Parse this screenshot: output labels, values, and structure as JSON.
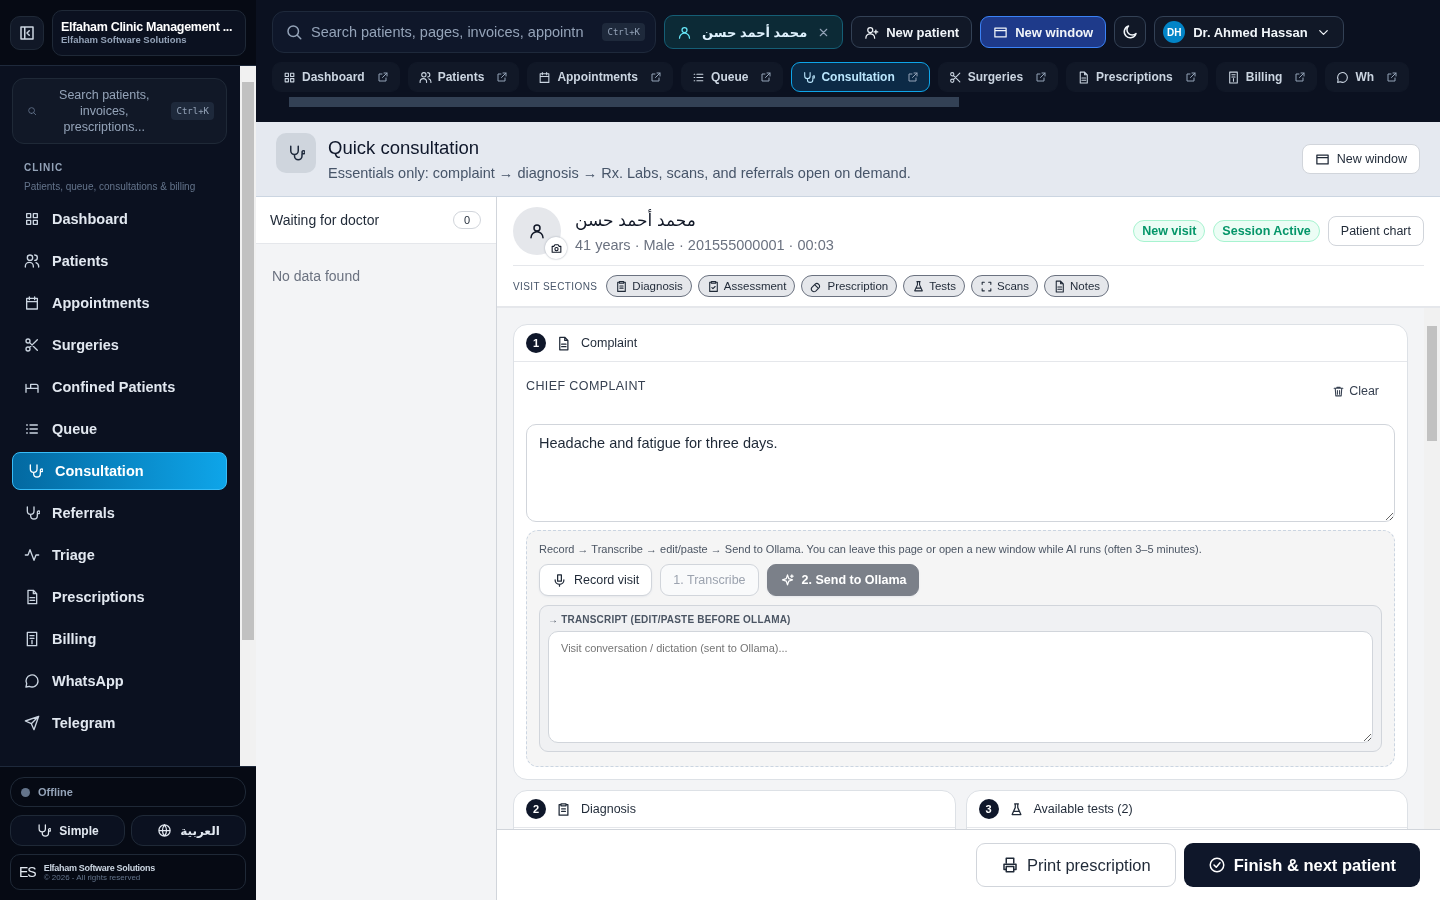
{
  "sidebar": {
    "brand": {
      "title": "Elfaham Clinic Management ...",
      "subtitle": "Elfaham Software Solutions"
    },
    "search": {
      "placeholder": "Search patients, invoices, prescriptions...",
      "shortcut": "Ctrl+K"
    },
    "section": {
      "title": "CLINIC",
      "subtitle": "Patients, queue, consultations & billing"
    },
    "items": [
      {
        "label": "Dashboard",
        "selected": false
      },
      {
        "label": "Patients",
        "selected": false
      },
      {
        "label": "Appointments",
        "selected": false
      },
      {
        "label": "Surgeries",
        "selected": false
      },
      {
        "label": "Confined Patients",
        "selected": false
      },
      {
        "label": "Queue",
        "selected": false
      },
      {
        "label": "Consultation",
        "selected": true
      },
      {
        "label": "Referrals",
        "selected": false
      },
      {
        "label": "Triage",
        "selected": false
      },
      {
        "label": "Prescriptions",
        "selected": false
      },
      {
        "label": "Billing",
        "selected": false
      },
      {
        "label": "WhatsApp",
        "selected": false
      },
      {
        "label": "Telegram",
        "selected": false
      }
    ],
    "status": {
      "label": "Offline",
      "online": false
    },
    "mode_button": "Simple",
    "language_button": "العربية",
    "footer": {
      "logo": "ES",
      "company": "Elfaham Software Solutions",
      "copyright": "© 2026 - All rights reserved"
    }
  },
  "topbar": {
    "search": {
      "placeholder": "Search patients, pages, invoices, appointn",
      "shortcut": "Ctrl+K"
    },
    "patient_chip": "محمد أحمد حسن",
    "new_patient": "New patient",
    "new_window": "New window",
    "user": {
      "initials": "DH",
      "name": "Dr. Ahmed Hassan"
    }
  },
  "tabs": [
    {
      "label": "Dashboard",
      "selected": false
    },
    {
      "label": "Patients",
      "selected": false
    },
    {
      "label": "Appointments",
      "selected": false
    },
    {
      "label": "Queue",
      "selected": false
    },
    {
      "label": "Consultation",
      "selected": true
    },
    {
      "label": "Surgeries",
      "selected": false
    },
    {
      "label": "Prescriptions",
      "selected": false
    },
    {
      "label": "Billing",
      "selected": false
    },
    {
      "label": "Wh",
      "selected": false
    }
  ],
  "page": {
    "title": "Quick consultation",
    "subtitle": "Essentials only: complaint → diagnosis → Rx. Labs, scans, and referrals open on demand.",
    "new_window": "New window"
  },
  "queue": {
    "title": "Waiting for doctor",
    "count": "0",
    "empty": "No data found"
  },
  "patient": {
    "name": "محمد أحمد حسن",
    "details": "41 years · Male · 201555000001 · 00:03",
    "badges": [
      "New visit",
      "Session Active"
    ],
    "chart_button": "Patient chart"
  },
  "visit_sections": {
    "label": "VISIT SECTIONS",
    "items": [
      "Diagnosis",
      "Assessment",
      "Prescription",
      "Tests",
      "Scans",
      "Notes"
    ]
  },
  "complaint": {
    "number": "1",
    "title": "Complaint",
    "field_label": "CHIEF COMPLAINT",
    "clear": "Clear",
    "value": "Headache and fatigue for three days.",
    "ai": {
      "hint": "Record → Transcribe → edit/paste → Send to Ollama. You can leave this page or open a new window while AI runs (often 3–5 minutes).",
      "record": "Record visit",
      "transcribe": {
        "label": "1. Transcribe",
        "disabled": true
      },
      "send": "2. Send to Ollama",
      "transcript_label": "→ TRANSCRIPT (EDIT/PASTE BEFORE OLLAMA)",
      "transcript_placeholder": "Visit conversation / dictation (sent to Ollama)..."
    }
  },
  "cards": [
    {
      "number": "2",
      "title": "Diagnosis"
    },
    {
      "number": "3",
      "title": "Available tests (2)"
    }
  ],
  "actions": {
    "print": "Print prescription",
    "finish": "Finish & next patient"
  }
}
